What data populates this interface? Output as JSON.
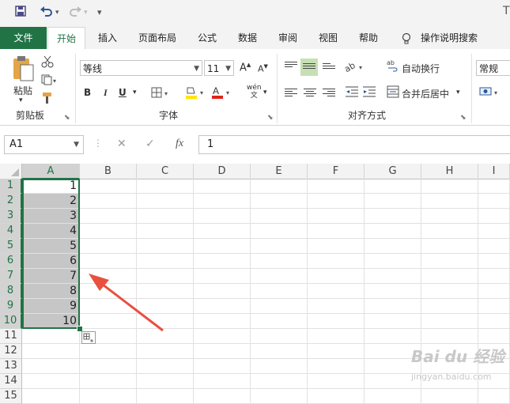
{
  "title_bar": {
    "right_char": "T"
  },
  "tabs": {
    "file": "文件",
    "home": "开始",
    "insert": "插入",
    "page_layout": "页面布局",
    "formulas": "公式",
    "data": "数据",
    "review": "审阅",
    "view": "视图",
    "help": "帮助",
    "tell_me": "操作说明搜索"
  },
  "ribbon": {
    "clipboard": {
      "paste": "粘贴",
      "label": "剪贴板"
    },
    "font": {
      "name": "等线",
      "size": "11",
      "label": "字体",
      "bold": "B",
      "italic": "I",
      "underline": "U",
      "phonetic_top": "wén",
      "phonetic_bottom": "文"
    },
    "alignment": {
      "wrap_text": "自动换行",
      "merge_center": "合并后居中",
      "label": "对齐方式"
    },
    "number": {
      "format": "常规"
    }
  },
  "formula_bar": {
    "name_box": "A1",
    "fx": "fx",
    "value": "1"
  },
  "columns": [
    "A",
    "B",
    "C",
    "D",
    "E",
    "F",
    "G",
    "H",
    "I"
  ],
  "rows": [
    "1",
    "2",
    "3",
    "4",
    "5",
    "6",
    "7",
    "8",
    "9",
    "10",
    "11",
    "12",
    "13",
    "14",
    "15"
  ],
  "cells_A": [
    "1",
    "2",
    "3",
    "4",
    "5",
    "6",
    "7",
    "8",
    "9",
    "10"
  ],
  "colors": {
    "accent": "#217346",
    "selection": "#c6c6c6",
    "annotation_arrow": "#e8503f"
  },
  "watermark": {
    "line1": "Bai du 经验",
    "line2": "jingyan.baidu.com"
  }
}
